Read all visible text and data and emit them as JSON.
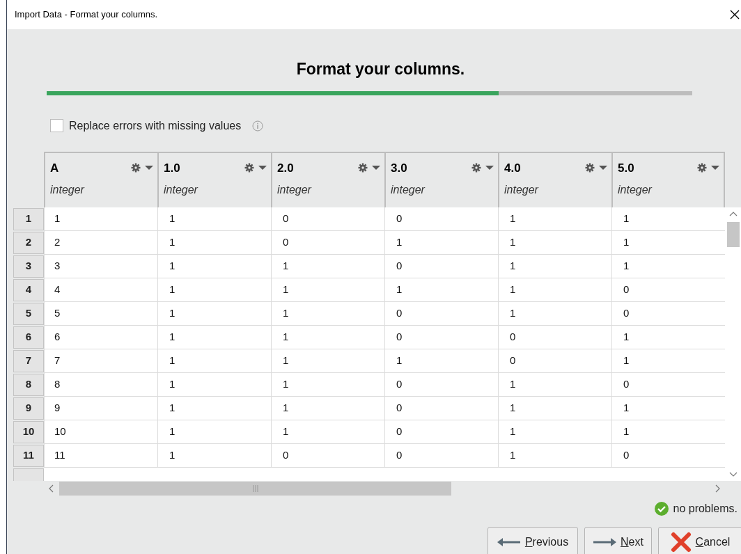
{
  "window": {
    "title": "Import Data - Format your columns."
  },
  "heading": "Format your columns.",
  "progress": {
    "level": 0.7
  },
  "replace_errors": {
    "label": "Replace errors with missing values",
    "checked": false
  },
  "columns": [
    {
      "name": "A",
      "type": "integer"
    },
    {
      "name": "1.0",
      "type": "integer"
    },
    {
      "name": "2.0",
      "type": "integer"
    },
    {
      "name": "3.0",
      "type": "integer"
    },
    {
      "name": "4.0",
      "type": "integer"
    },
    {
      "name": "5.0",
      "type": "integer"
    }
  ],
  "rows": [
    {
      "index": "1",
      "cells": [
        "1",
        "1",
        "0",
        "0",
        "1",
        "1"
      ]
    },
    {
      "index": "2",
      "cells": [
        "2",
        "1",
        "0",
        "1",
        "1",
        "1"
      ]
    },
    {
      "index": "3",
      "cells": [
        "3",
        "1",
        "1",
        "0",
        "1",
        "1"
      ]
    },
    {
      "index": "4",
      "cells": [
        "4",
        "1",
        "1",
        "1",
        "1",
        "0"
      ]
    },
    {
      "index": "5",
      "cells": [
        "5",
        "1",
        "1",
        "0",
        "1",
        "0"
      ]
    },
    {
      "index": "6",
      "cells": [
        "6",
        "1",
        "1",
        "0",
        "0",
        "1"
      ]
    },
    {
      "index": "7",
      "cells": [
        "7",
        "1",
        "1",
        "1",
        "0",
        "1"
      ]
    },
    {
      "index": "8",
      "cells": [
        "8",
        "1",
        "1",
        "0",
        "1",
        "0"
      ]
    },
    {
      "index": "9",
      "cells": [
        "9",
        "1",
        "1",
        "0",
        "1",
        "1"
      ]
    },
    {
      "index": "10",
      "cells": [
        "10",
        "1",
        "1",
        "0",
        "1",
        "1"
      ]
    },
    {
      "index": "11",
      "cells": [
        "11",
        "1",
        "0",
        "0",
        "1",
        "0"
      ]
    }
  ],
  "status": "no problems.",
  "buttons": [
    {
      "kind": "previous",
      "accel": "P",
      "rest": "revious"
    },
    {
      "kind": "next",
      "accel": "N",
      "rest": "ext"
    },
    {
      "kind": "cancel",
      "accel": "C",
      "rest": "ancel"
    }
  ]
}
